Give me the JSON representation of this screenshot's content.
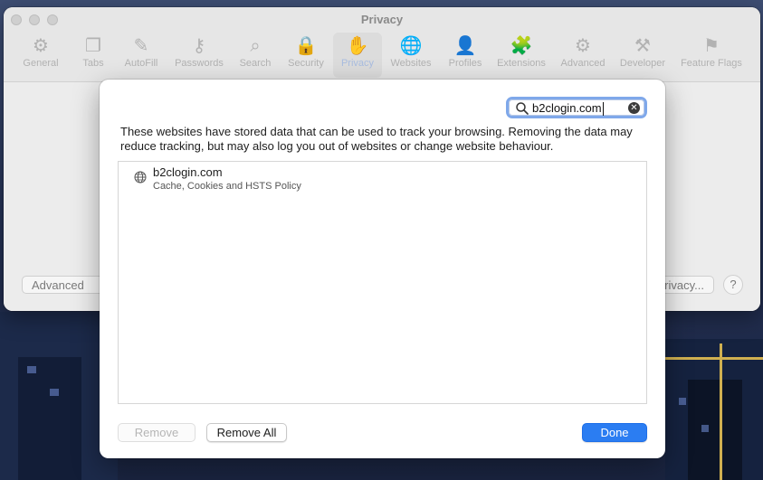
{
  "window": {
    "title": "Privacy",
    "toolbar": [
      {
        "label": "General",
        "icon": "gear-icon",
        "glyph": "⚙"
      },
      {
        "label": "Tabs",
        "icon": "tabs-icon",
        "glyph": "❐"
      },
      {
        "label": "AutoFill",
        "icon": "autofill-icon",
        "glyph": "✎"
      },
      {
        "label": "Passwords",
        "icon": "key-icon",
        "glyph": "⚷"
      },
      {
        "label": "Search",
        "icon": "magnifier-icon",
        "glyph": "⌕"
      },
      {
        "label": "Security",
        "icon": "lock-icon",
        "glyph": "🔒"
      },
      {
        "label": "Privacy",
        "icon": "hand-icon",
        "glyph": "✋"
      },
      {
        "label": "Websites",
        "icon": "globe-icon",
        "glyph": "🌐"
      },
      {
        "label": "Profiles",
        "icon": "person-icon",
        "glyph": "👤"
      },
      {
        "label": "Extensions",
        "icon": "puzzle-icon",
        "glyph": "🧩"
      },
      {
        "label": "Advanced",
        "icon": "gears-icon",
        "glyph": "⚙"
      },
      {
        "label": "Developer",
        "icon": "tools-icon",
        "glyph": "⚒"
      },
      {
        "label": "Feature Flags",
        "icon": "flags-icon",
        "glyph": "⚑"
      }
    ],
    "active_tab": "Privacy",
    "background_buttons": {
      "advanced": "Advanced Se",
      "privacy": "rivacy...",
      "help": "?"
    }
  },
  "sheet": {
    "search": {
      "value": "b2clogin.com"
    },
    "description": "These websites have stored data that can be used to track your browsing. Removing the data may reduce tracking, but may also log you out of websites or change website behaviour.",
    "sites": [
      {
        "name": "b2clogin.com",
        "detail": "Cache, Cookies and HSTS Policy",
        "icon": "globe-icon"
      }
    ],
    "buttons": {
      "remove": "Remove",
      "remove_all": "Remove All",
      "done": "Done"
    }
  },
  "colors": {
    "accent": "#2b7df2",
    "focus_ring": "#7fa8ea"
  }
}
